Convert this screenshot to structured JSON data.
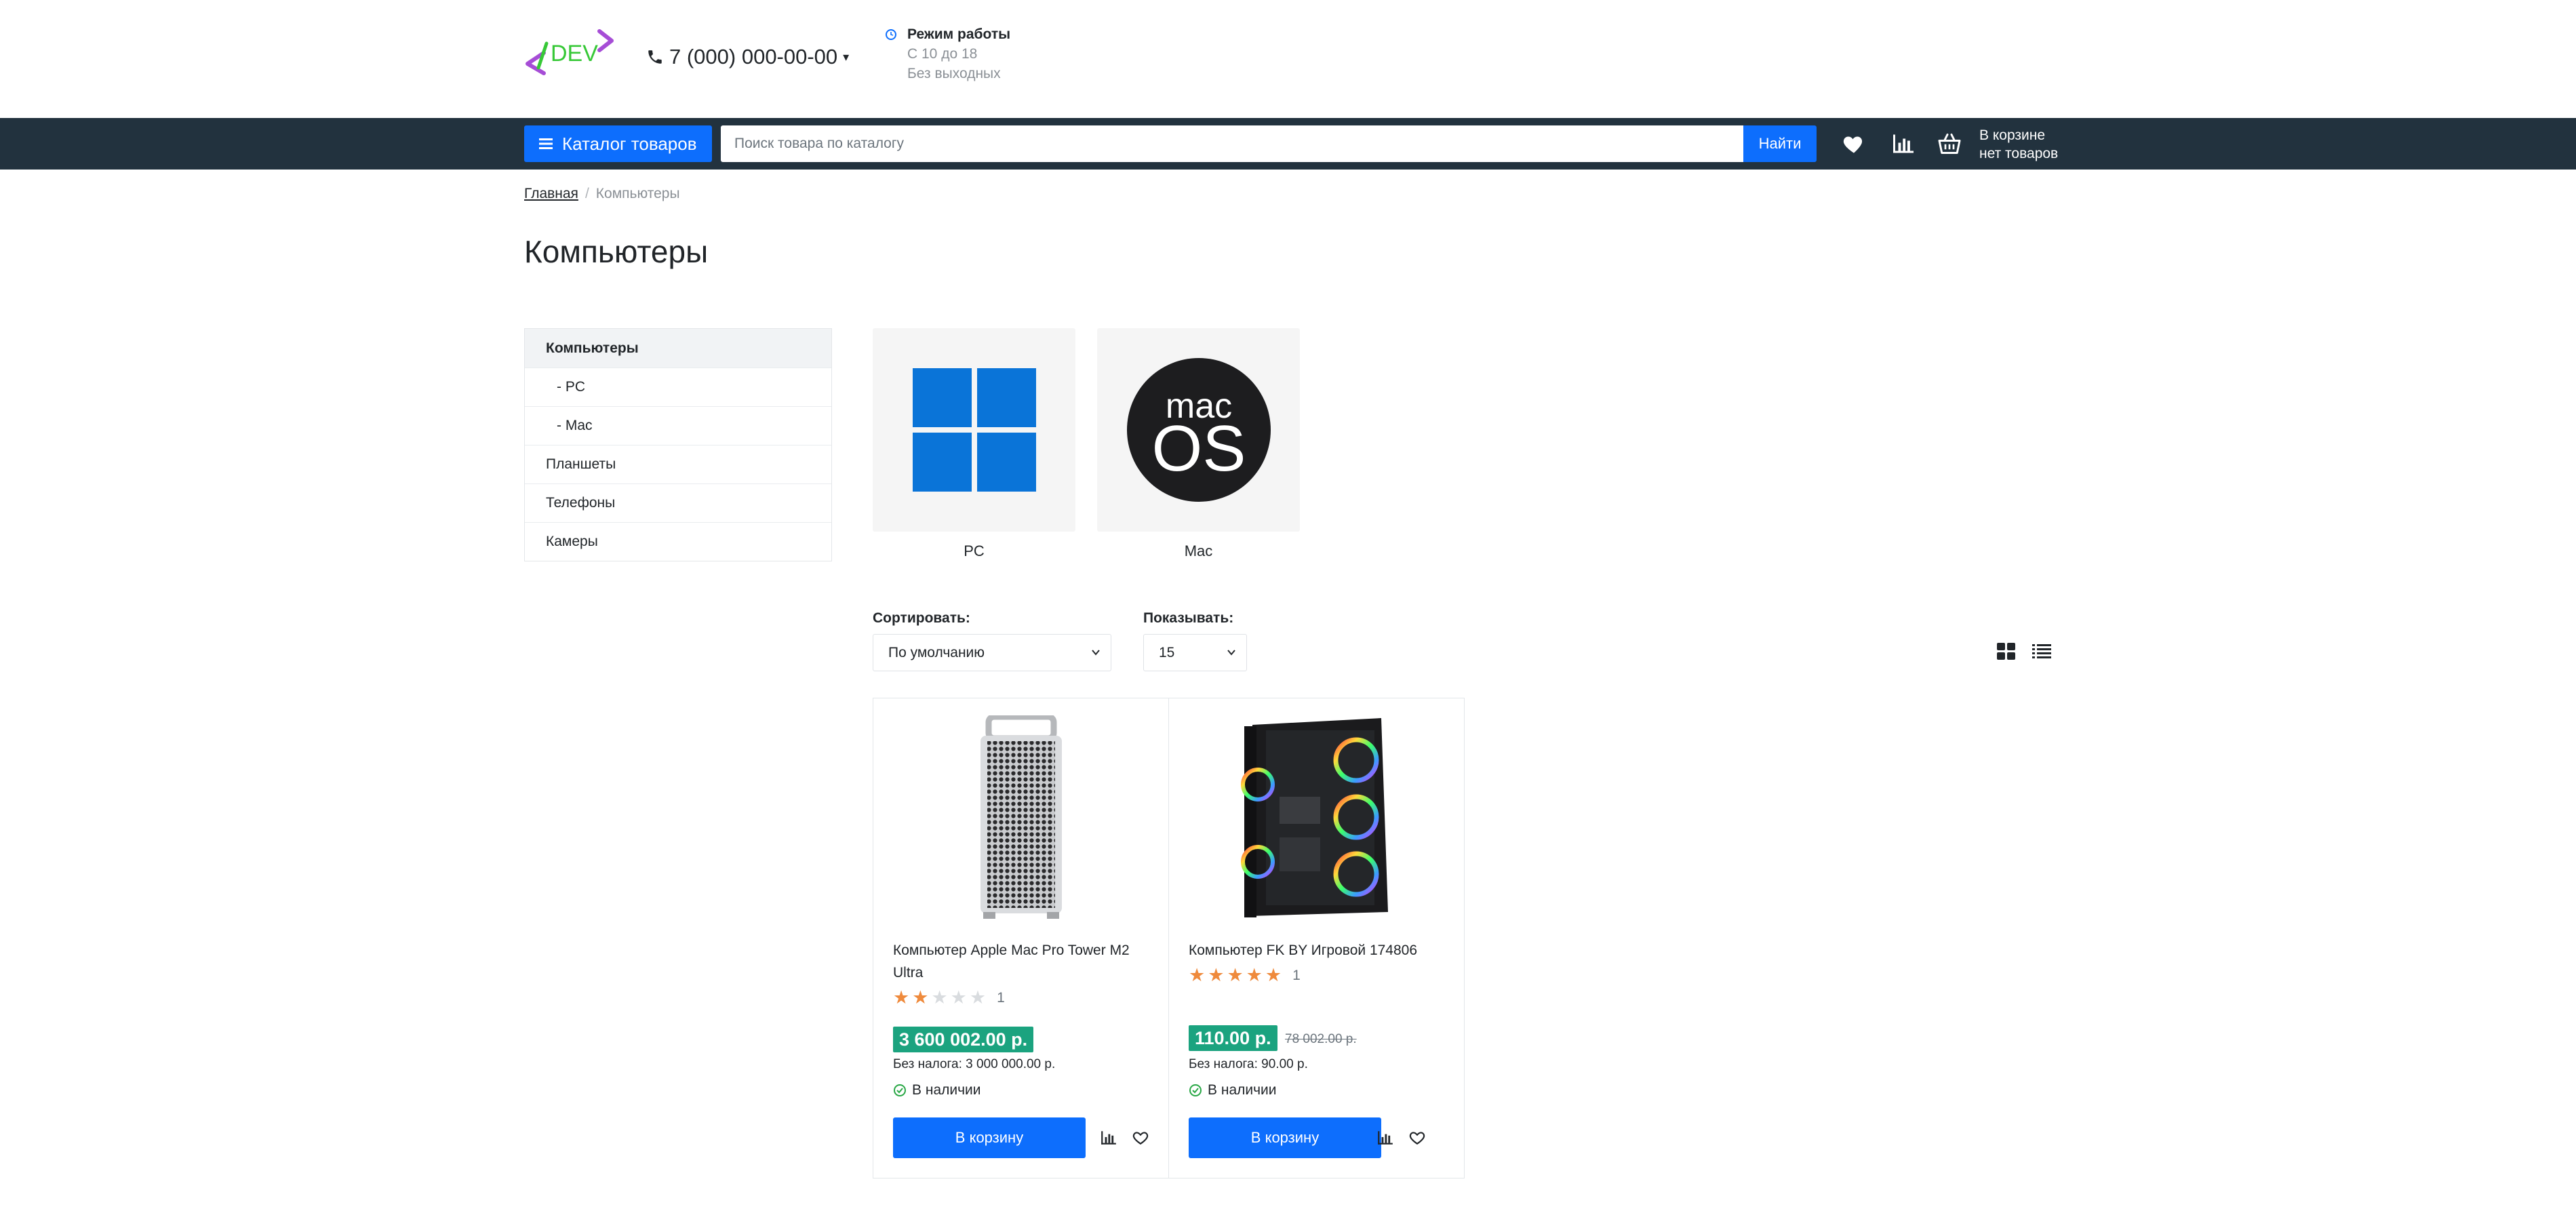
{
  "header": {
    "logo_text": "DEV",
    "phone": "7 (000) 000-00-00",
    "hours_title": "Режим работы",
    "hours_line1": "С 10 до 18",
    "hours_line2": "Без выходных"
  },
  "navbar": {
    "catalog_label": "Каталог товаров",
    "search_placeholder": "Поиск товара по каталогу",
    "search_button": "Найти",
    "cart_line1": "В корзине",
    "cart_line2": "нет товаров"
  },
  "breadcrumb": {
    "home": "Главная",
    "separator": "/",
    "current": "Компьютеры"
  },
  "page_title": "Компьютеры",
  "sidebar": {
    "items": [
      {
        "label": "Компьютеры"
      },
      {
        "label": "- PC"
      },
      {
        "label": "- Mac"
      },
      {
        "label": "Планшеты"
      },
      {
        "label": "Телефоны"
      },
      {
        "label": "Камеры"
      }
    ]
  },
  "subcategories": [
    {
      "label": "PC",
      "icon": "windows-logo-icon"
    },
    {
      "label": "Mac",
      "icon": "macos-logo-icon",
      "logo_line1": "mac",
      "logo_line2": "OS"
    }
  ],
  "controls": {
    "sort_label": "Сортировать:",
    "sort_value": "По умолчанию",
    "show_label": "Показывать:",
    "show_value": "15"
  },
  "products": [
    {
      "name": "Компьютер Apple Mac Pro Tower M2 Ultra",
      "rating": 2,
      "rating_max": 5,
      "reviews": "1",
      "price": "3 600 002.00 р.",
      "old_price": "",
      "tax": "Без налога: 3 000 000.00 р.",
      "stock": "В наличии",
      "buy_label": "В корзину"
    },
    {
      "name": "Компьютер FK BY Игровой 174806",
      "rating": 5,
      "rating_max": 5,
      "reviews": "1",
      "price": "110.00 р.",
      "old_price": "78 002.00 р.",
      "tax": "Без налога: 90.00 р.",
      "stock": "В наличии",
      "buy_label": "В корзину"
    }
  ],
  "colors": {
    "navbar": "#22323e",
    "primary": "#0d6efd",
    "price": "#1ba37f",
    "star": "#ef8a3c",
    "in_stock": "#28a745"
  }
}
